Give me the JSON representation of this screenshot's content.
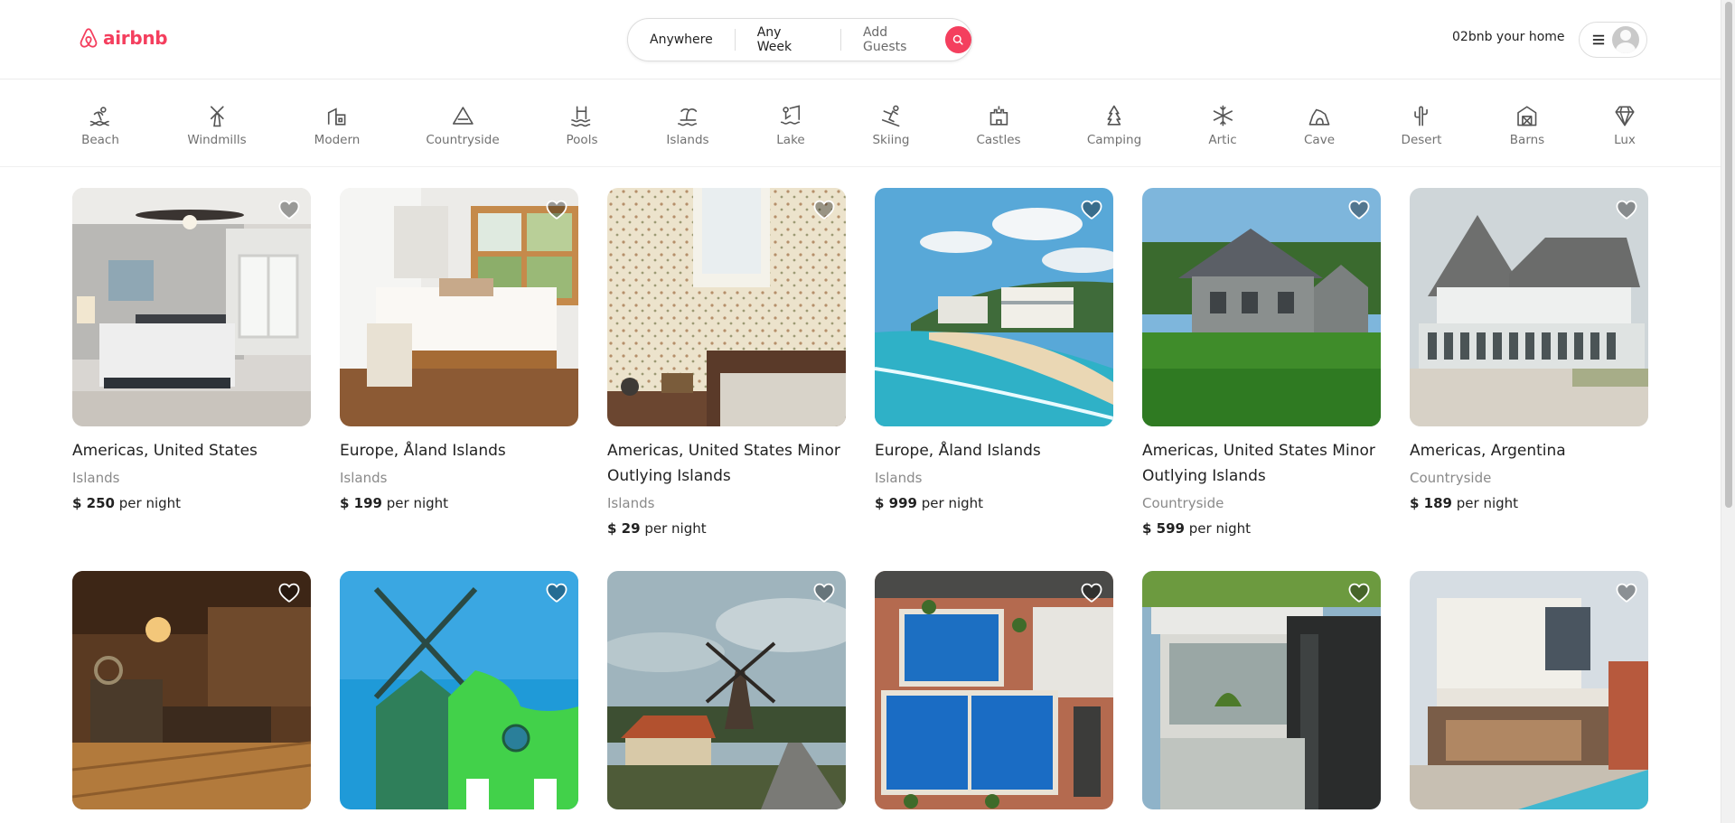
{
  "header": {
    "logo_text": "airbnb",
    "search": {
      "anywhere": "Anywhere",
      "any_week": "Any Week",
      "add_guests": "Add Guests"
    },
    "host_link": "02bnb your home"
  },
  "categories": [
    {
      "label": "Beach",
      "icon": "beach-icon"
    },
    {
      "label": "Windmills",
      "icon": "windmill-icon"
    },
    {
      "label": "Modern",
      "icon": "modern-house-icon"
    },
    {
      "label": "Countryside",
      "icon": "mountain-icon"
    },
    {
      "label": "Pools",
      "icon": "pool-icon"
    },
    {
      "label": "Islands",
      "icon": "island-icon"
    },
    {
      "label": "Lake",
      "icon": "lake-icon"
    },
    {
      "label": "Skiing",
      "icon": "skiing-icon"
    },
    {
      "label": "Castles",
      "icon": "castle-icon"
    },
    {
      "label": "Camping",
      "icon": "camping-icon"
    },
    {
      "label": "Artic",
      "icon": "snowflake-icon"
    },
    {
      "label": "Cave",
      "icon": "cave-icon"
    },
    {
      "label": "Desert",
      "icon": "cactus-icon"
    },
    {
      "label": "Barns",
      "icon": "barn-icon"
    },
    {
      "label": "Lux",
      "icon": "diamond-icon"
    }
  ],
  "listings": [
    {
      "location": "Americas, United States",
      "category": "Islands",
      "price": "$ 250",
      "unit": "per night"
    },
    {
      "location": "Europe, Åland Islands",
      "category": "Islands",
      "price": "$ 199",
      "unit": "per night"
    },
    {
      "location": "Americas, United States Minor Outlying Islands",
      "category": "Islands",
      "price": "$ 29",
      "unit": "per night"
    },
    {
      "location": "Europe, Åland Islands",
      "category": "Islands",
      "price": "$ 999",
      "unit": "per night"
    },
    {
      "location": "Americas, United States Minor Outlying Islands",
      "category": "Countryside",
      "price": "$ 599",
      "unit": "per night"
    },
    {
      "location": "Americas, Argentina",
      "category": "Countryside",
      "price": "$ 189",
      "unit": "per night"
    }
  ],
  "colors": {
    "brand": "#f43f5e",
    "text": "#222222",
    "muted": "#717171"
  }
}
